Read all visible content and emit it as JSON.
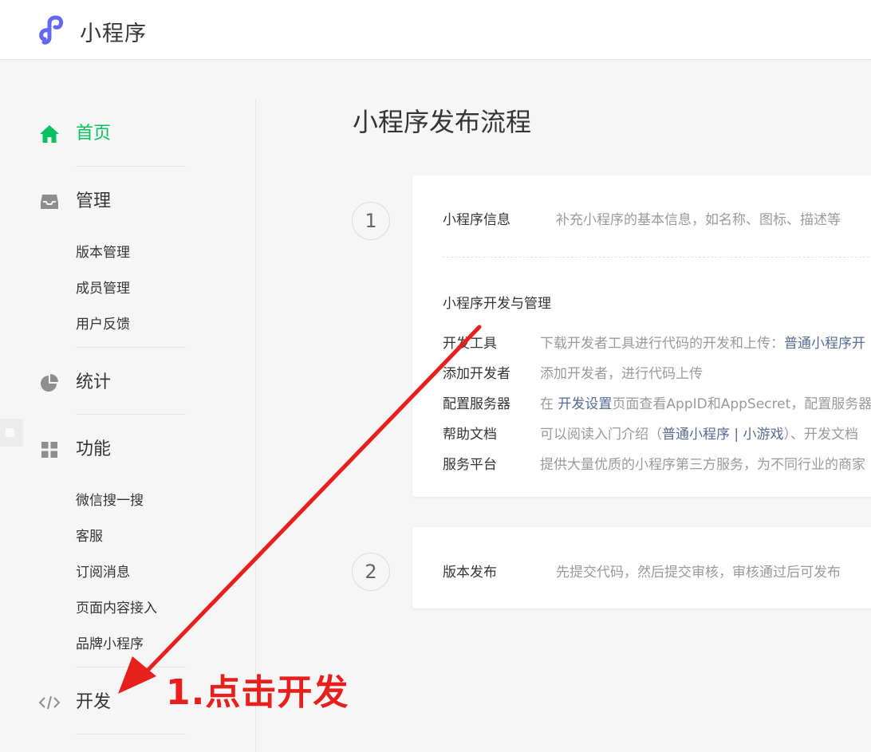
{
  "header": {
    "title": "小程序"
  },
  "sidebar": {
    "home": "首页",
    "manage": {
      "label": "管理",
      "items": [
        "版本管理",
        "成员管理",
        "用户反馈"
      ]
    },
    "stats": "统计",
    "features": {
      "label": "功能",
      "items": [
        "微信搜一搜",
        "客服",
        "订阅消息",
        "页面内容接入",
        "品牌小程序"
      ]
    },
    "develop": "开发"
  },
  "main": {
    "title": "小程序发布流程",
    "step1": {
      "number": "1",
      "info_label": "小程序信息",
      "info_desc": "补充小程序的基本信息，如名称、图标、描述等",
      "section_title": "小程序开发与管理",
      "rows": [
        {
          "label": "开发工具",
          "desc": "下载开发者工具进行代码的开发和上传：",
          "link": "普通小程序开"
        },
        {
          "label": "添加开发者",
          "desc": "添加开发者，进行代码上传"
        },
        {
          "label": "配置服务器",
          "pre": "在 ",
          "link": "开发设置",
          "desc": "页面查看AppID和AppSecret，配置服务器"
        },
        {
          "label": "帮助文档",
          "pre": "可以阅读入门介绍（",
          "link1": "普通小程序",
          "sep": " | ",
          "link2": "小游戏",
          "desc": "）、开发文档"
        },
        {
          "label": "服务平台",
          "desc": "提供大量优质的小程序第三方服务，为不同行业的商家"
        }
      ]
    },
    "step2": {
      "number": "2",
      "label": "版本发布",
      "desc": "先提交代码，然后提交审核，审核通过后可发布"
    }
  },
  "annotation": {
    "text": "1.点击开发"
  },
  "colors": {
    "accent": "#07c160",
    "link": "#576b95",
    "annotation": "#e8201d",
    "logo": "#6467f0"
  },
  "icons": {
    "logo": "mini-program-logo",
    "home": "home-icon",
    "manage": "inbox-icon",
    "stats": "pie-chart-icon",
    "features": "grid-icon",
    "develop": "code-icon"
  }
}
